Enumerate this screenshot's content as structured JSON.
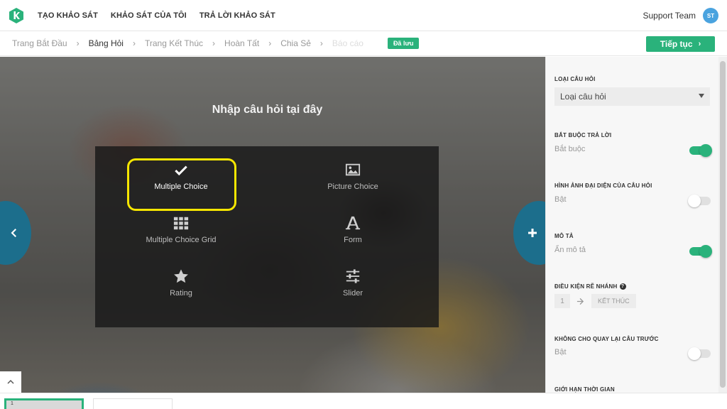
{
  "nav": {
    "links": [
      "TẠO KHẢO SÁT",
      "KHẢO SÁT CỦA TÔI",
      "TRẢ LỜI KHẢO SÁT"
    ],
    "user_name": "Support Team",
    "avatar_initials": "ST"
  },
  "breadcrumb": {
    "items": [
      "Trang Bắt Đầu",
      "Bảng Hỏi",
      "Trang Kết Thúc",
      "Hoàn Tất",
      "Chia Sẻ",
      "Báo cáo"
    ],
    "active_index": 1,
    "saved_label": "Đã lưu",
    "next_label": "Tiếp tục"
  },
  "editor": {
    "question_placeholder": "Nhập câu hỏi tại đây",
    "question_types": [
      {
        "label": "Multiple Choice",
        "icon": "check-icon",
        "selected": true
      },
      {
        "label": "Picture Choice",
        "icon": "image-icon",
        "selected": false
      },
      {
        "label": "Multiple Choice Grid",
        "icon": "grid-icon",
        "selected": false
      },
      {
        "label": "Form",
        "icon": "letter-a-icon",
        "selected": false
      },
      {
        "label": "Rating",
        "icon": "star-icon",
        "selected": false
      },
      {
        "label": "Slider",
        "icon": "sliders-icon",
        "selected": false
      }
    ]
  },
  "settings": {
    "question_type_label": "LOẠI CÂU HỎI",
    "question_type_value": "Loại câu hỏi",
    "required_label": "BẮT BUỘC TRẢ LỜI",
    "required_value": "Bắt buộc",
    "required_on": true,
    "image_label": "HÌNH ẢNH ĐẠI DIỆN CỦA CÂU HỎI",
    "image_value": "Bật",
    "image_on": false,
    "description_label": "MÔ TẢ",
    "description_value": "Ẩn mô tả",
    "description_on": true,
    "branch_label": "ĐIỀU KIỆN RẼ NHÁNH",
    "branch_from": "1",
    "branch_to": "KẾT THÚC",
    "no_back_label": "KHÔNG CHO QUAY LẠI CÂU TRƯỚC",
    "no_back_value": "Bật",
    "no_back_on": false,
    "time_limit_label": "GIỚI HẠN THỜI GIAN"
  },
  "pages": {
    "thumb_1_label": "1"
  },
  "colors": {
    "accent": "#2ab27b",
    "highlight": "#f6e600",
    "arrow_bg": "#1c6e8c"
  }
}
